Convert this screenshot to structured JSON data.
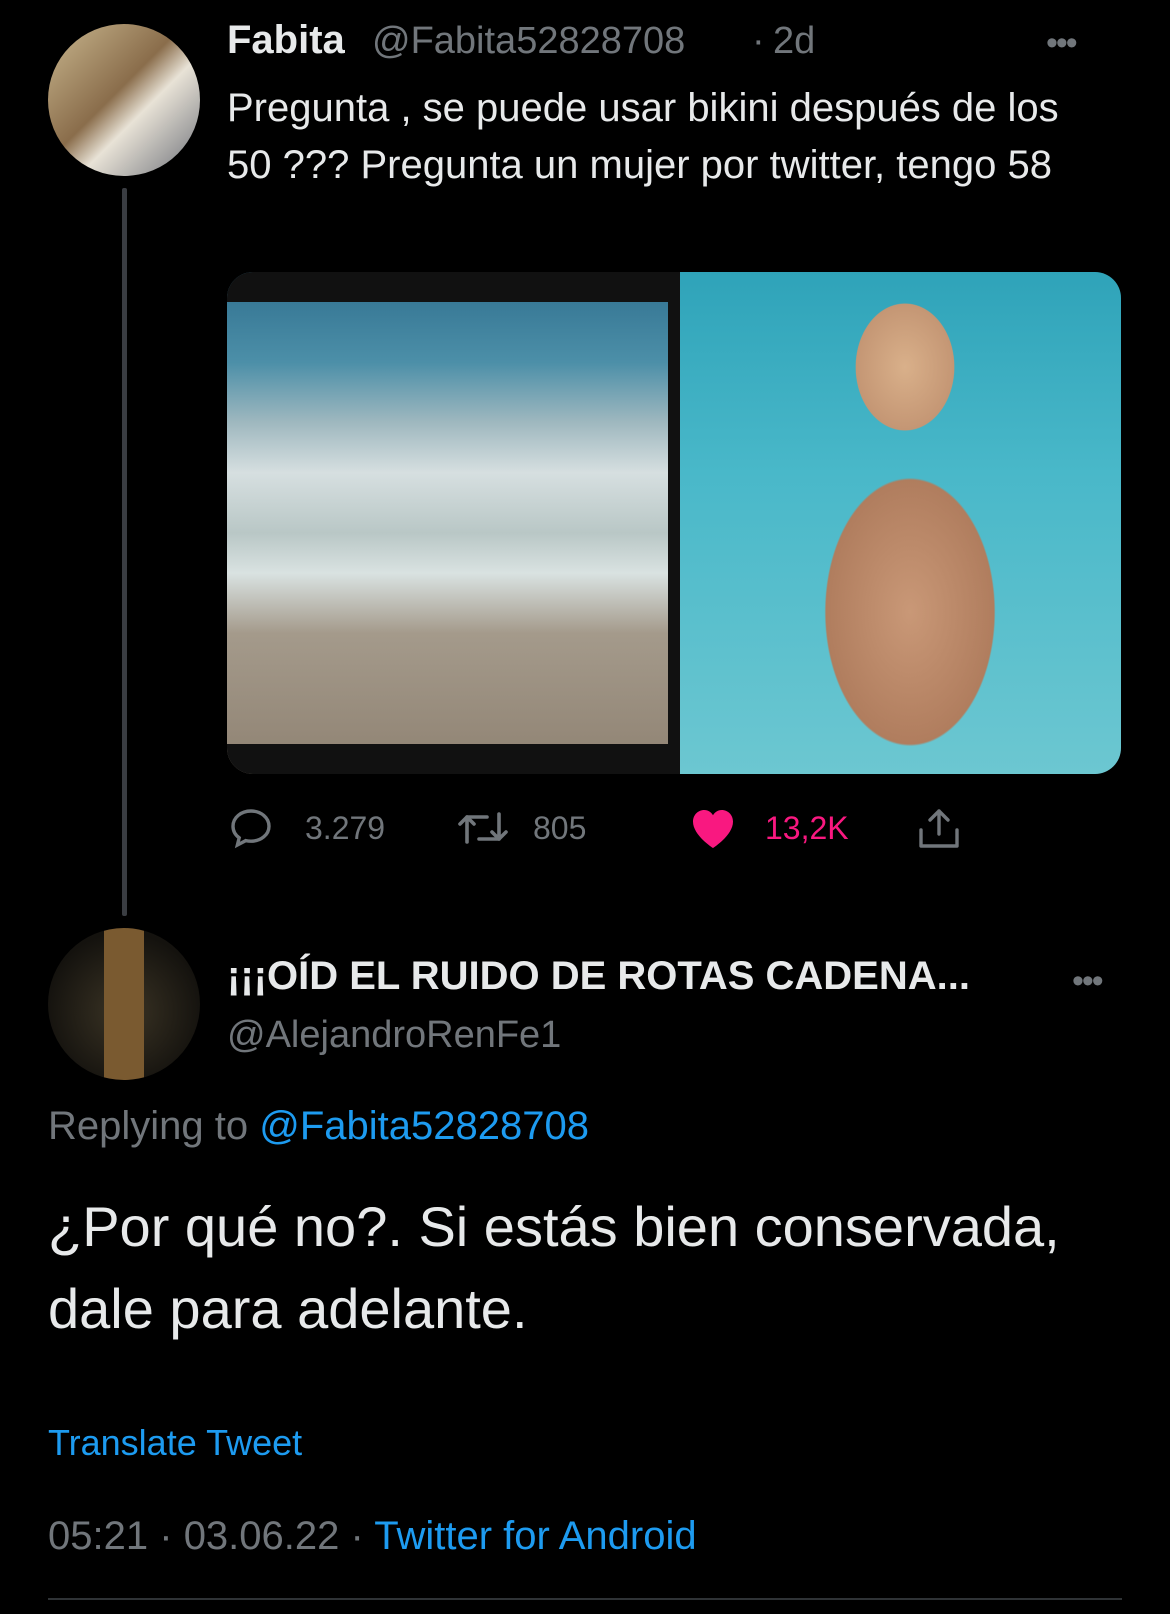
{
  "tweet": {
    "author_name": "Fabita",
    "author_handle": "@Fabita52828708",
    "separator": "·",
    "time": "2d",
    "text": "Pregunta , se puede usar bikini después de los 50 ??? Pregunta un mujer por twitter, tengo 58",
    "more_label": "•••",
    "stats": {
      "replies": "3.279",
      "retweets": "805",
      "likes": "13,2K"
    },
    "liked": true,
    "colors": {
      "like_active": "#f91880",
      "muted": "#71767b"
    },
    "media_count": 2
  },
  "reply": {
    "author_name": "¡¡¡OÍD EL RUIDO DE ROTAS CADENA...",
    "author_handle": "@AlejandroRenFe1",
    "more_label": "•••",
    "replying_prefix": "Replying to",
    "replying_to": "@Fabita52828708",
    "text": "¿Por qué no?. Si estás bien conservada, dale para adelante.",
    "translate_label": "Translate Tweet",
    "time": "05:21",
    "date": "03.06.22",
    "separator": "·",
    "source": "Twitter for Android",
    "colors": {
      "link": "#1d9bf0"
    }
  }
}
